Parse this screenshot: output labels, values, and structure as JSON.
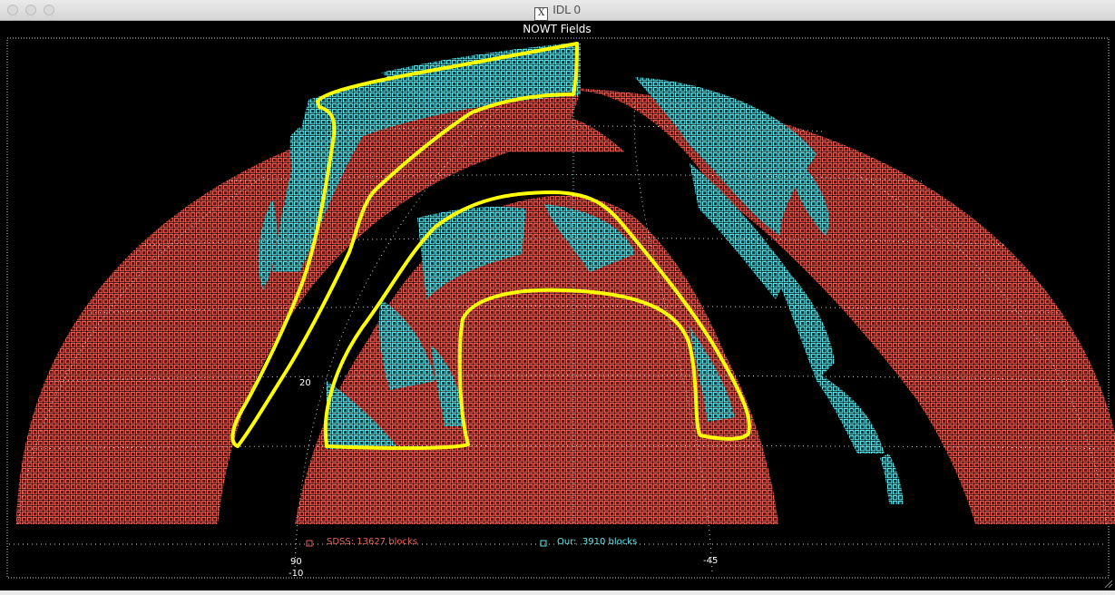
{
  "window": {
    "title": "IDL 0",
    "app_icon": "x11-icon"
  },
  "plot": {
    "title": "NOWT Fields",
    "colors": {
      "sdss": "#e8635a",
      "ours": "#66e3e8",
      "outline": "#ffff00",
      "grid": "#cfcfcf",
      "text": "#ffffff"
    },
    "legend": {
      "sdss": "SDSS: 13627 blocks",
      "ours": "Our:  3910 blocks"
    },
    "labels": {
      "ra_left": "90",
      "ra_right": "-45",
      "dec_mid": "20",
      "dec_low": "-10"
    }
  }
}
